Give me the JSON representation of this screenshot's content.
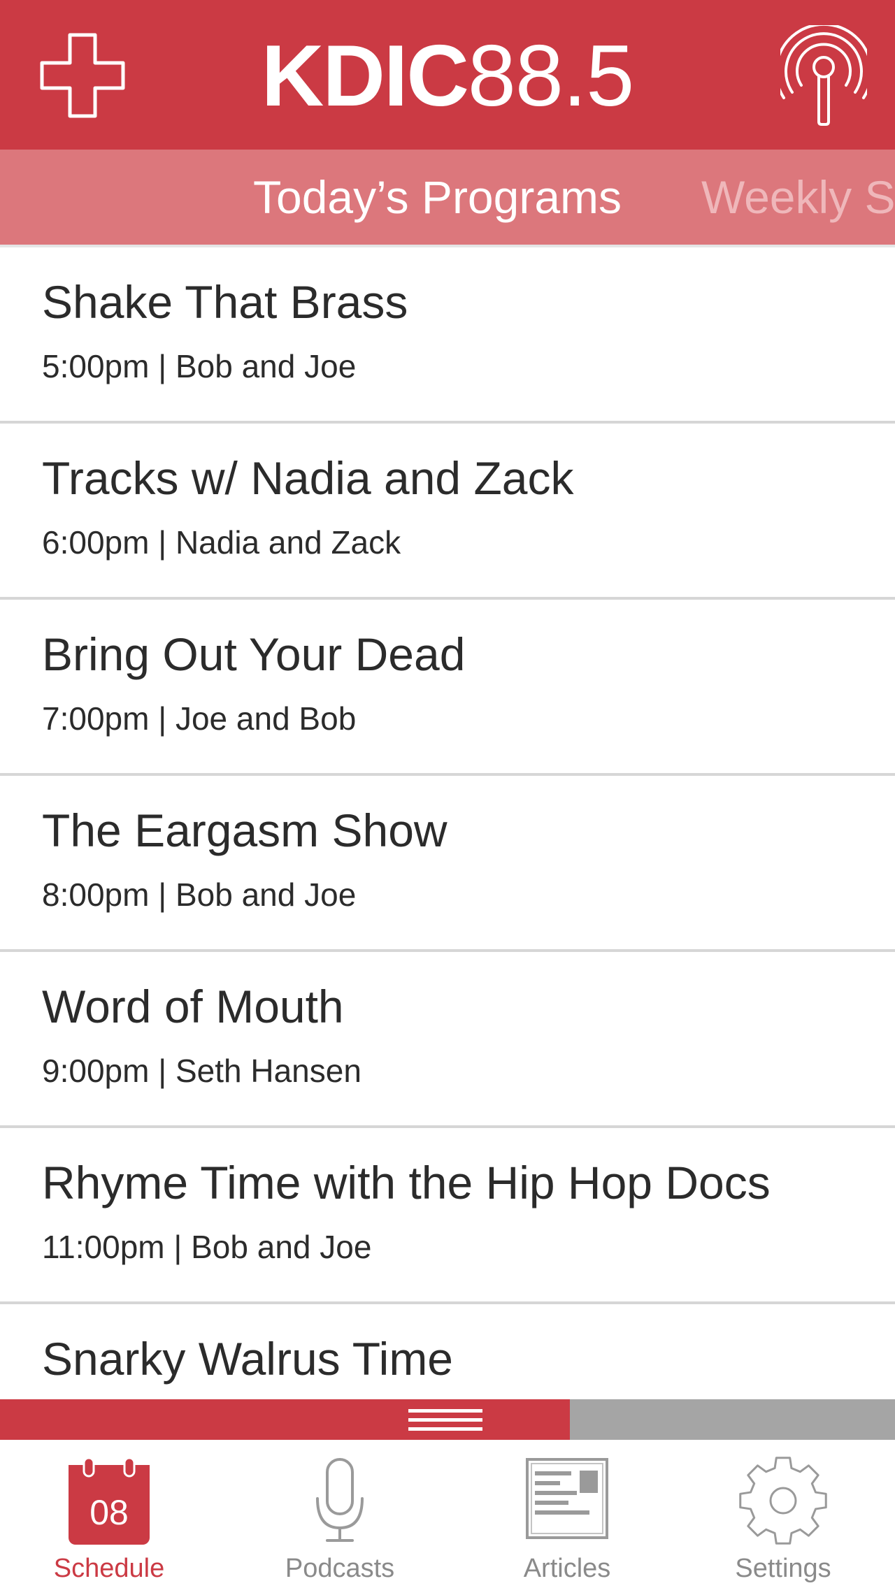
{
  "colors": {
    "brand_red": "#cb3a44",
    "tab_strip": "#dc777c",
    "inactive_tab_text": "#efb7ba",
    "player_track": "#a5a5a5",
    "tabbar_inactive": "#8a8a8a"
  },
  "header": {
    "logo_call": "KDIC",
    "logo_freq": "88.5",
    "add_icon": "plus-icon",
    "stream_icon": "broadcast-icon"
  },
  "tabs": [
    {
      "label": "Today’s Programs",
      "active": true
    },
    {
      "label": "Weekly S",
      "active": false
    }
  ],
  "programs": [
    {
      "title": "Shake That Brass",
      "time": "5:00pm",
      "hosts": "Bob and Joe"
    },
    {
      "title": "Tracks w/ Nadia and Zack",
      "time": "6:00pm",
      "hosts": "Nadia and Zack"
    },
    {
      "title": "Bring Out Your Dead",
      "time": "7:00pm",
      "hosts": "Joe and Bob"
    },
    {
      "title": "The Eargasm Show",
      "time": "8:00pm",
      "hosts": "Bob and Joe"
    },
    {
      "title": "Word of Mouth",
      "time": "9:00pm",
      "hosts": "Seth Hansen"
    },
    {
      "title": "Rhyme Time with the Hip Hop Docs",
      "time": "11:00pm",
      "hosts": "Bob and Joe"
    },
    {
      "title": "Snarky Walrus Time",
      "time": "",
      "hosts": ""
    }
  ],
  "player": {
    "progress": 0.637,
    "handle_icon": "drag-handle-icon"
  },
  "tabbar": {
    "items": [
      {
        "label": "Schedule",
        "icon": "calendar-icon",
        "calendar_day": "08",
        "active": true
      },
      {
        "label": "Podcasts",
        "icon": "microphone-icon",
        "active": false
      },
      {
        "label": "Articles",
        "icon": "newspaper-icon",
        "active": false
      },
      {
        "label": "Settings",
        "icon": "gear-icon",
        "active": false
      }
    ]
  }
}
